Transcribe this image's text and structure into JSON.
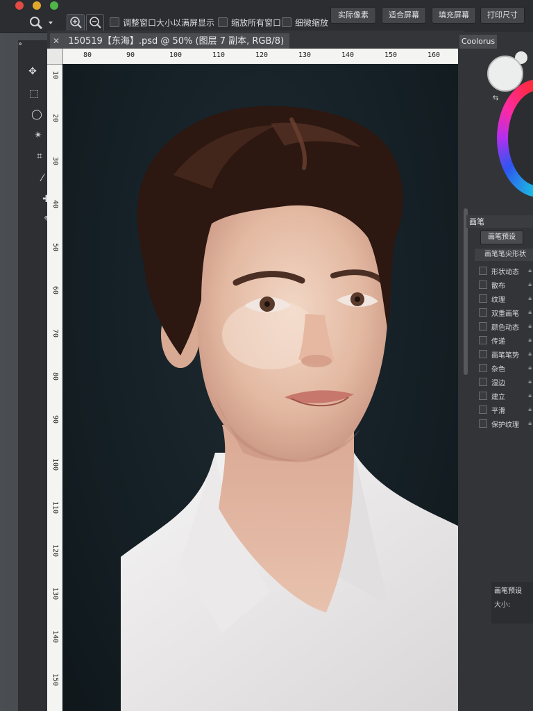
{
  "options_bar": {
    "check_resize_label": "调整窗口大小以满屏显示",
    "check_zoom_all_label": "缩放所有窗口",
    "check_scrubby_label": "细微缩放",
    "btn_actual_pixels": "实际像素",
    "btn_fit_screen": "适合屏幕",
    "btn_fill_screen": "填充屏幕",
    "btn_print_size": "打印尺寸"
  },
  "document": {
    "tab_title": "150519【东海】.psd @ 50% (图层 7 副本, RGB/8)"
  },
  "ruler": {
    "h_ticks": [
      "80",
      "90",
      "100",
      "110",
      "120",
      "130",
      "140",
      "150",
      "160"
    ],
    "v_ticks": [
      "10",
      "20",
      "30",
      "40",
      "50",
      "60",
      "70",
      "80",
      "90",
      "100",
      "110",
      "120",
      "130",
      "140",
      "150"
    ]
  },
  "right_panel": {
    "color_tab": "Coolorus",
    "brush_tab": "画笔",
    "preset_button": "画笔预设",
    "tip_shape": "画笔笔尖形状",
    "options": [
      "形状动态",
      "散布",
      "纹理",
      "双重画笔",
      "颜色动态",
      "传递",
      "画笔笔势",
      "杂色",
      "湿边",
      "建立",
      "平滑",
      "保护纹理"
    ],
    "section2_title": "画笔预设",
    "section2_size_label": "大小:"
  },
  "colors": {
    "canvas_bg": "#152026",
    "ui_dark": "#2b2d30",
    "accent_red": "#e24b43"
  }
}
